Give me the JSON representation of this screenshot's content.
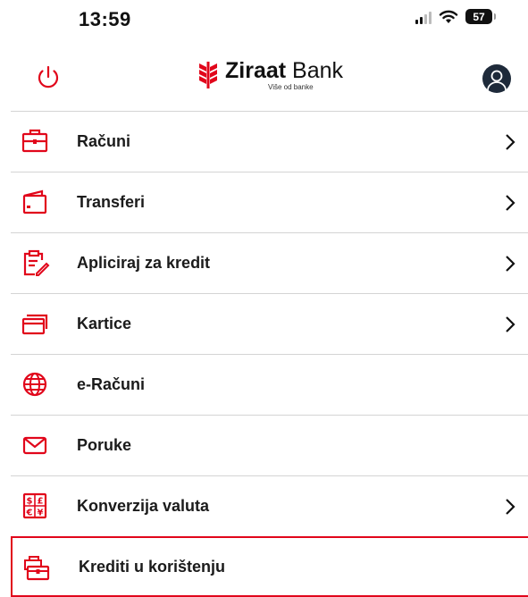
{
  "status_bar": {
    "time": "13:59",
    "battery": "57"
  },
  "header": {
    "brand_name_bold": "Ziraat",
    "brand_name_regular": " Bank",
    "tagline": "Više od banke"
  },
  "menu": {
    "items": [
      {
        "label": "Računi",
        "icon": "briefcase-icon",
        "has_chevron": true
      },
      {
        "label": "Transferi",
        "icon": "wallet-icon",
        "has_chevron": true
      },
      {
        "label": "Apliciraj za kredit",
        "icon": "clipboard-edit-icon",
        "has_chevron": true
      },
      {
        "label": "Kartice",
        "icon": "card-icon",
        "has_chevron": true
      },
      {
        "label": "e-Računi",
        "icon": "globe-icon",
        "has_chevron": false
      },
      {
        "label": "Poruke",
        "icon": "envelope-icon",
        "has_chevron": false
      },
      {
        "label": "Konverzija valuta",
        "icon": "currency-exchange-icon",
        "has_chevron": true
      },
      {
        "label": "Krediti u korištenju",
        "icon": "loan-case-icon",
        "has_chevron": false,
        "selected": true
      }
    ]
  },
  "colors": {
    "accent": "#e1061b",
    "text": "#1b1b1b",
    "divider": "#d4d4d4",
    "avatar": "#1e2a3a"
  }
}
